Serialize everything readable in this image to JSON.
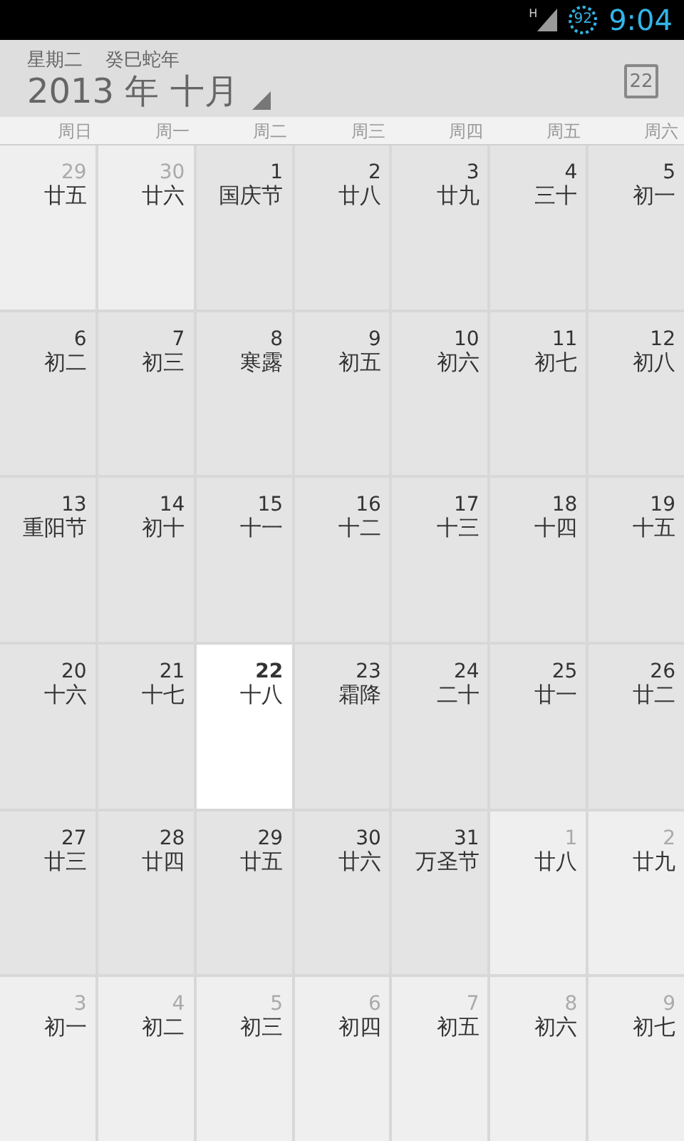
{
  "status_bar": {
    "network": "H",
    "battery": "92",
    "time": "9:04"
  },
  "header": {
    "weekday": "星期二",
    "lunar_year": "癸巳蛇年",
    "title": "2013 年 十月",
    "today_button": "22"
  },
  "weekdays": [
    "周日",
    "周一",
    "周二",
    "周三",
    "周四",
    "周五",
    "周六"
  ],
  "days": [
    {
      "day": "29",
      "lunar": "廿五",
      "in_month": false,
      "today": false
    },
    {
      "day": "30",
      "lunar": "廿六",
      "in_month": false,
      "today": false
    },
    {
      "day": "1",
      "lunar": "国庆节",
      "in_month": true,
      "today": false
    },
    {
      "day": "2",
      "lunar": "廿八",
      "in_month": true,
      "today": false
    },
    {
      "day": "3",
      "lunar": "廿九",
      "in_month": true,
      "today": false
    },
    {
      "day": "4",
      "lunar": "三十",
      "in_month": true,
      "today": false
    },
    {
      "day": "5",
      "lunar": "初一",
      "in_month": true,
      "today": false
    },
    {
      "day": "6",
      "lunar": "初二",
      "in_month": true,
      "today": false
    },
    {
      "day": "7",
      "lunar": "初三",
      "in_month": true,
      "today": false
    },
    {
      "day": "8",
      "lunar": "寒露",
      "in_month": true,
      "today": false
    },
    {
      "day": "9",
      "lunar": "初五",
      "in_month": true,
      "today": false
    },
    {
      "day": "10",
      "lunar": "初六",
      "in_month": true,
      "today": false
    },
    {
      "day": "11",
      "lunar": "初七",
      "in_month": true,
      "today": false
    },
    {
      "day": "12",
      "lunar": "初八",
      "in_month": true,
      "today": false
    },
    {
      "day": "13",
      "lunar": "重阳节",
      "in_month": true,
      "today": false
    },
    {
      "day": "14",
      "lunar": "初十",
      "in_month": true,
      "today": false
    },
    {
      "day": "15",
      "lunar": "十一",
      "in_month": true,
      "today": false
    },
    {
      "day": "16",
      "lunar": "十二",
      "in_month": true,
      "today": false
    },
    {
      "day": "17",
      "lunar": "十三",
      "in_month": true,
      "today": false
    },
    {
      "day": "18",
      "lunar": "十四",
      "in_month": true,
      "today": false
    },
    {
      "day": "19",
      "lunar": "十五",
      "in_month": true,
      "today": false
    },
    {
      "day": "20",
      "lunar": "十六",
      "in_month": true,
      "today": false
    },
    {
      "day": "21",
      "lunar": "十七",
      "in_month": true,
      "today": false
    },
    {
      "day": "22",
      "lunar": "十八",
      "in_month": true,
      "today": true
    },
    {
      "day": "23",
      "lunar": "霜降",
      "in_month": true,
      "today": false
    },
    {
      "day": "24",
      "lunar": "二十",
      "in_month": true,
      "today": false
    },
    {
      "day": "25",
      "lunar": "廿一",
      "in_month": true,
      "today": false
    },
    {
      "day": "26",
      "lunar": "廿二",
      "in_month": true,
      "today": false
    },
    {
      "day": "27",
      "lunar": "廿三",
      "in_month": true,
      "today": false
    },
    {
      "day": "28",
      "lunar": "廿四",
      "in_month": true,
      "today": false
    },
    {
      "day": "29",
      "lunar": "廿五",
      "in_month": true,
      "today": false
    },
    {
      "day": "30",
      "lunar": "廿六",
      "in_month": true,
      "today": false
    },
    {
      "day": "31",
      "lunar": "万圣节",
      "in_month": true,
      "today": false
    },
    {
      "day": "1",
      "lunar": "廿八",
      "in_month": false,
      "today": false
    },
    {
      "day": "2",
      "lunar": "廿九",
      "in_month": false,
      "today": false
    },
    {
      "day": "3",
      "lunar": "初一",
      "in_month": false,
      "today": false
    },
    {
      "day": "4",
      "lunar": "初二",
      "in_month": false,
      "today": false
    },
    {
      "day": "5",
      "lunar": "初三",
      "in_month": false,
      "today": false
    },
    {
      "day": "6",
      "lunar": "初四",
      "in_month": false,
      "today": false
    },
    {
      "day": "7",
      "lunar": "初五",
      "in_month": false,
      "today": false
    },
    {
      "day": "8",
      "lunar": "初六",
      "in_month": false,
      "today": false
    },
    {
      "day": "9",
      "lunar": "初七",
      "in_month": false,
      "today": false
    }
  ]
}
